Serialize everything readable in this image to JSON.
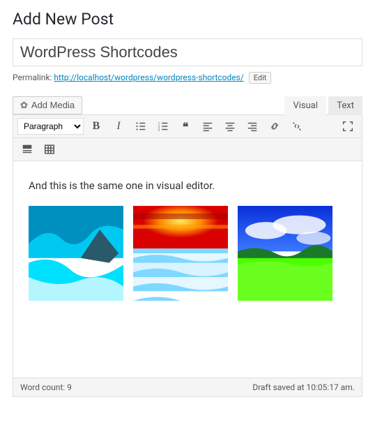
{
  "page": {
    "heading": "Add New Post"
  },
  "post": {
    "title": "WordPress Shortcodes"
  },
  "permalink": {
    "label": "Permalink:",
    "url": "http://localhost/wordpress/wordpress-shortcodes/",
    "edit_label": "Edit"
  },
  "media_button": {
    "label": "Add Media"
  },
  "editor_tabs": {
    "visual": "Visual",
    "text": "Text",
    "active": "visual"
  },
  "format_dropdown": {
    "selected": "Paragraph"
  },
  "toolbar": {
    "bold_glyph": "B",
    "italic_glyph": "I",
    "quote_glyph": "❝"
  },
  "content": {
    "paragraph": "And this is the same one in visual editor."
  },
  "status": {
    "word_count_label": "Word count: 9",
    "save_status": "Draft saved at 10:05:17 am."
  }
}
